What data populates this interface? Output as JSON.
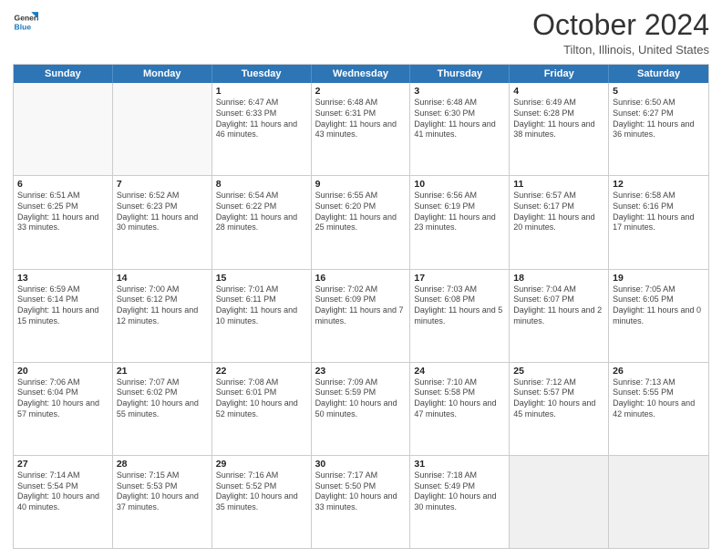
{
  "header": {
    "logo_line1": "General",
    "logo_line2": "Blue",
    "month_title": "October 2024",
    "location": "Tilton, Illinois, United States"
  },
  "days_of_week": [
    "Sunday",
    "Monday",
    "Tuesday",
    "Wednesday",
    "Thursday",
    "Friday",
    "Saturday"
  ],
  "weeks": [
    [
      {
        "day": "",
        "info": ""
      },
      {
        "day": "",
        "info": ""
      },
      {
        "day": "1",
        "info": "Sunrise: 6:47 AM\nSunset: 6:33 PM\nDaylight: 11 hours and 46 minutes."
      },
      {
        "day": "2",
        "info": "Sunrise: 6:48 AM\nSunset: 6:31 PM\nDaylight: 11 hours and 43 minutes."
      },
      {
        "day": "3",
        "info": "Sunrise: 6:48 AM\nSunset: 6:30 PM\nDaylight: 11 hours and 41 minutes."
      },
      {
        "day": "4",
        "info": "Sunrise: 6:49 AM\nSunset: 6:28 PM\nDaylight: 11 hours and 38 minutes."
      },
      {
        "day": "5",
        "info": "Sunrise: 6:50 AM\nSunset: 6:27 PM\nDaylight: 11 hours and 36 minutes."
      }
    ],
    [
      {
        "day": "6",
        "info": "Sunrise: 6:51 AM\nSunset: 6:25 PM\nDaylight: 11 hours and 33 minutes."
      },
      {
        "day": "7",
        "info": "Sunrise: 6:52 AM\nSunset: 6:23 PM\nDaylight: 11 hours and 30 minutes."
      },
      {
        "day": "8",
        "info": "Sunrise: 6:54 AM\nSunset: 6:22 PM\nDaylight: 11 hours and 28 minutes."
      },
      {
        "day": "9",
        "info": "Sunrise: 6:55 AM\nSunset: 6:20 PM\nDaylight: 11 hours and 25 minutes."
      },
      {
        "day": "10",
        "info": "Sunrise: 6:56 AM\nSunset: 6:19 PM\nDaylight: 11 hours and 23 minutes."
      },
      {
        "day": "11",
        "info": "Sunrise: 6:57 AM\nSunset: 6:17 PM\nDaylight: 11 hours and 20 minutes."
      },
      {
        "day": "12",
        "info": "Sunrise: 6:58 AM\nSunset: 6:16 PM\nDaylight: 11 hours and 17 minutes."
      }
    ],
    [
      {
        "day": "13",
        "info": "Sunrise: 6:59 AM\nSunset: 6:14 PM\nDaylight: 11 hours and 15 minutes."
      },
      {
        "day": "14",
        "info": "Sunrise: 7:00 AM\nSunset: 6:12 PM\nDaylight: 11 hours and 12 minutes."
      },
      {
        "day": "15",
        "info": "Sunrise: 7:01 AM\nSunset: 6:11 PM\nDaylight: 11 hours and 10 minutes."
      },
      {
        "day": "16",
        "info": "Sunrise: 7:02 AM\nSunset: 6:09 PM\nDaylight: 11 hours and 7 minutes."
      },
      {
        "day": "17",
        "info": "Sunrise: 7:03 AM\nSunset: 6:08 PM\nDaylight: 11 hours and 5 minutes."
      },
      {
        "day": "18",
        "info": "Sunrise: 7:04 AM\nSunset: 6:07 PM\nDaylight: 11 hours and 2 minutes."
      },
      {
        "day": "19",
        "info": "Sunrise: 7:05 AM\nSunset: 6:05 PM\nDaylight: 11 hours and 0 minutes."
      }
    ],
    [
      {
        "day": "20",
        "info": "Sunrise: 7:06 AM\nSunset: 6:04 PM\nDaylight: 10 hours and 57 minutes."
      },
      {
        "day": "21",
        "info": "Sunrise: 7:07 AM\nSunset: 6:02 PM\nDaylight: 10 hours and 55 minutes."
      },
      {
        "day": "22",
        "info": "Sunrise: 7:08 AM\nSunset: 6:01 PM\nDaylight: 10 hours and 52 minutes."
      },
      {
        "day": "23",
        "info": "Sunrise: 7:09 AM\nSunset: 5:59 PM\nDaylight: 10 hours and 50 minutes."
      },
      {
        "day": "24",
        "info": "Sunrise: 7:10 AM\nSunset: 5:58 PM\nDaylight: 10 hours and 47 minutes."
      },
      {
        "day": "25",
        "info": "Sunrise: 7:12 AM\nSunset: 5:57 PM\nDaylight: 10 hours and 45 minutes."
      },
      {
        "day": "26",
        "info": "Sunrise: 7:13 AM\nSunset: 5:55 PM\nDaylight: 10 hours and 42 minutes."
      }
    ],
    [
      {
        "day": "27",
        "info": "Sunrise: 7:14 AM\nSunset: 5:54 PM\nDaylight: 10 hours and 40 minutes."
      },
      {
        "day": "28",
        "info": "Sunrise: 7:15 AM\nSunset: 5:53 PM\nDaylight: 10 hours and 37 minutes."
      },
      {
        "day": "29",
        "info": "Sunrise: 7:16 AM\nSunset: 5:52 PM\nDaylight: 10 hours and 35 minutes."
      },
      {
        "day": "30",
        "info": "Sunrise: 7:17 AM\nSunset: 5:50 PM\nDaylight: 10 hours and 33 minutes."
      },
      {
        "day": "31",
        "info": "Sunrise: 7:18 AM\nSunset: 5:49 PM\nDaylight: 10 hours and 30 minutes."
      },
      {
        "day": "",
        "info": ""
      },
      {
        "day": "",
        "info": ""
      }
    ]
  ]
}
